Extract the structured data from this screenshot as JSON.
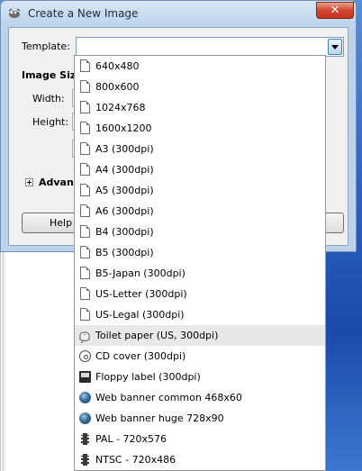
{
  "window": {
    "title": "Create a New Image",
    "close_label": "✕"
  },
  "form": {
    "template_label": "Template:",
    "template_value": "",
    "image_size_label": "Image Size",
    "width_label": "Width:",
    "height_label": "Height:",
    "advanced_label": "Advanc",
    "help_label": "Help"
  },
  "dropdown": {
    "items": [
      {
        "label": "640x480",
        "icon": "page-icon"
      },
      {
        "label": "800x600",
        "icon": "page-icon"
      },
      {
        "label": "1024x768",
        "icon": "page-icon"
      },
      {
        "label": "1600x1200",
        "icon": "page-icon"
      },
      {
        "label": "A3 (300dpi)",
        "icon": "page-icon"
      },
      {
        "label": "A4 (300dpi)",
        "icon": "page-icon"
      },
      {
        "label": "A5 (300dpi)",
        "icon": "page-icon"
      },
      {
        "label": "A6 (300dpi)",
        "icon": "page-icon"
      },
      {
        "label": "B4 (300dpi)",
        "icon": "page-icon"
      },
      {
        "label": "B5 (300dpi)",
        "icon": "page-icon"
      },
      {
        "label": "B5-Japan (300dpi)",
        "icon": "page-icon"
      },
      {
        "label": "US-Letter (300dpi)",
        "icon": "page-icon"
      },
      {
        "label": "US-Legal (300dpi)",
        "icon": "page-icon"
      },
      {
        "label": "Toilet paper (US, 300dpi)",
        "icon": "toilet-roll-icon"
      },
      {
        "label": "CD cover (300dpi)",
        "icon": "cd-icon"
      },
      {
        "label": "Floppy label (300dpi)",
        "icon": "floppy-icon"
      },
      {
        "label": "Web banner common 468x60",
        "icon": "globe-icon"
      },
      {
        "label": "Web banner huge 728x90",
        "icon": "globe-icon"
      },
      {
        "label": "PAL - 720x576",
        "icon": "film-icon"
      },
      {
        "label": "NTSC - 720x486",
        "icon": "film-icon"
      }
    ],
    "highlighted": "Toilet paper (US, 300dpi)"
  }
}
